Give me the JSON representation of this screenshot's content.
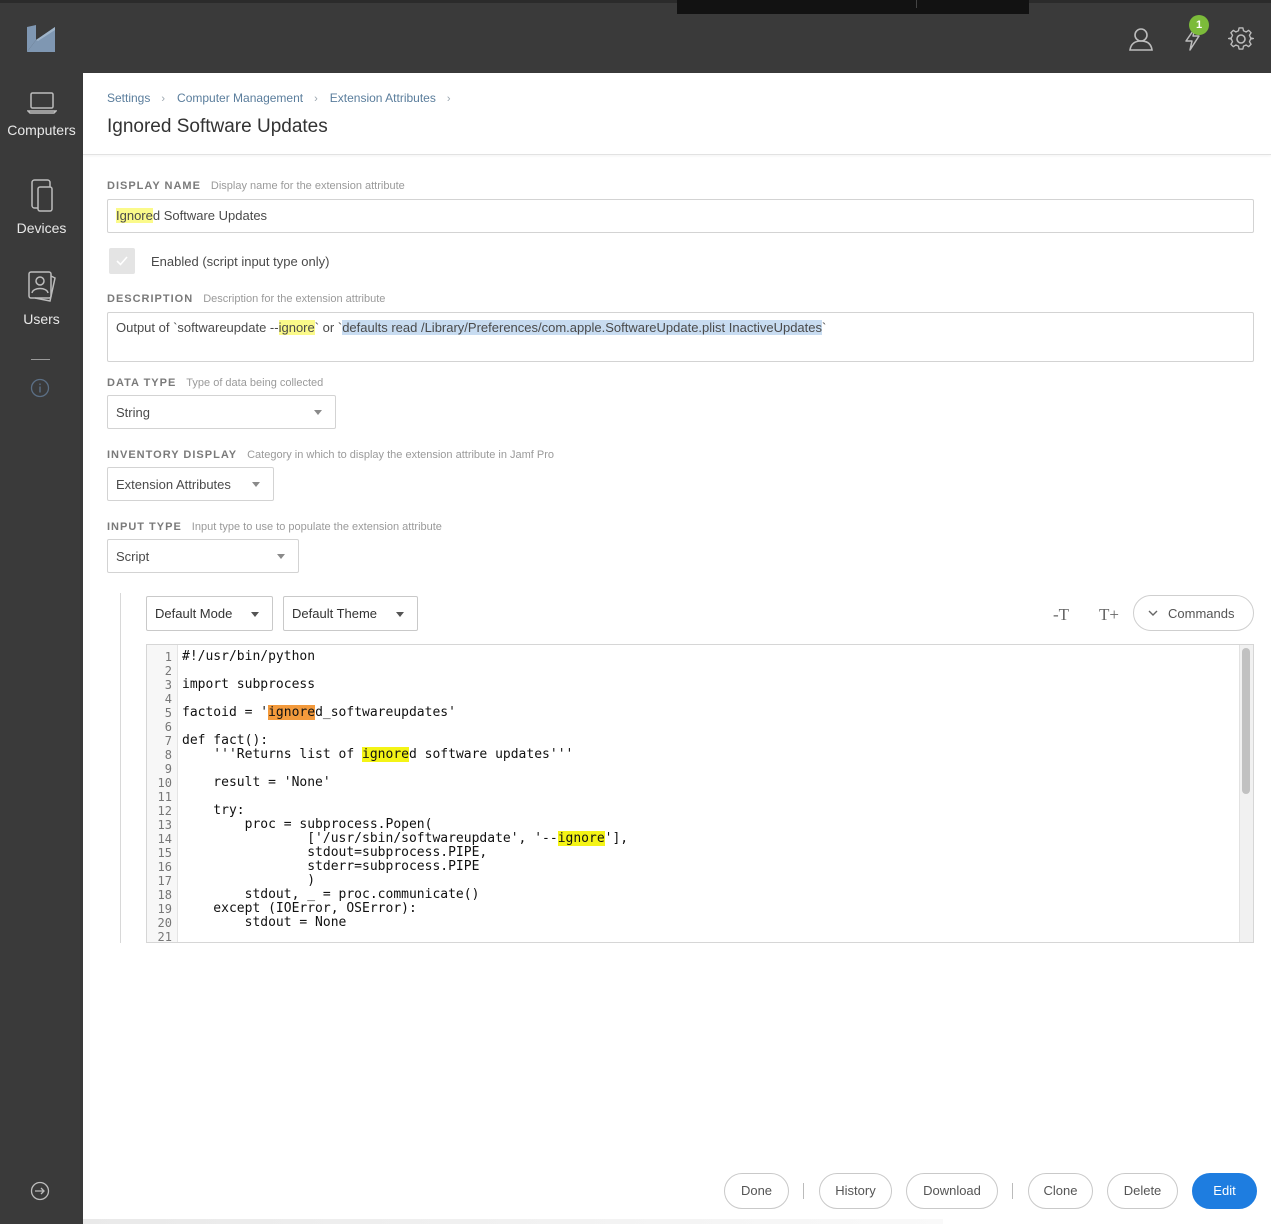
{
  "topbar": {
    "notification_count": "1",
    "icons": [
      "jamf-logo-icon",
      "user-icon",
      "lightning-icon",
      "gear-icon"
    ]
  },
  "sidebar": {
    "items": [
      {
        "label": "Computers",
        "icon": "laptop-icon"
      },
      {
        "label": "Devices",
        "icon": "mobile-devices-icon"
      },
      {
        "label": "Users",
        "icon": "users-icon"
      }
    ]
  },
  "breadcrumb": [
    "Settings",
    "Computer Management",
    "Extension Attributes"
  ],
  "page_title": "Ignored Software Updates",
  "display_name": {
    "label": "DISPLAY NAME",
    "hint": "Display name for the extension attribute",
    "value_hl": "Ignore",
    "value_rest": "d Software Updates"
  },
  "enabled": {
    "label": "Enabled (script input type only)",
    "checked": true
  },
  "description": {
    "label": "DESCRIPTION",
    "hint": "Description for the extension attribute",
    "part1": "Output of `softwareupdate --",
    "part2": "ignore",
    "part3": "` or `",
    "part4": "defaults read /Library/Preferences/com.apple.SoftwareUpdate.plist InactiveUpdates",
    "part5": "`"
  },
  "data_type": {
    "label": "DATA TYPE",
    "hint": "Type of data being collected",
    "value": "String"
  },
  "inventory_display": {
    "label": "INVENTORY DISPLAY",
    "hint": "Category in which to display the extension attribute in Jamf Pro",
    "value": "Extension Attributes"
  },
  "input_type": {
    "label": "INPUT TYPE",
    "hint": "Input type to use to populate the extension attribute",
    "value": "Script"
  },
  "editor": {
    "mode": "Default Mode",
    "theme": "Default Theme",
    "font_decrease": "-T",
    "font_increase": "T+",
    "commands_label": "Commands",
    "line_numbers": [
      "1",
      "2",
      "3",
      "4",
      "5",
      "6",
      "7",
      "8",
      "9",
      "10",
      "11",
      "12",
      "13",
      "14",
      "15",
      "16",
      "17",
      "18",
      "19",
      "20",
      "21"
    ],
    "code": {
      "l1": "#!/usr/bin/python",
      "l3": "import subprocess",
      "l5a": "factoid = '",
      "l5b": "ignore",
      "l5c": "d_softwareupdates'",
      "l7": "def fact():",
      "l8a": "    '''Returns list of ",
      "l8b": "ignore",
      "l8c": "d software updates'''",
      "l10": "    result = 'None'",
      "l12": "    try:",
      "l13": "        proc = subprocess.Popen(",
      "l14a": "                ['/usr/sbin/softwareupdate', '--",
      "l14b": "ignore",
      "l14c": "'],",
      "l15": "                stdout=subprocess.PIPE,",
      "l16": "                stderr=subprocess.PIPE",
      "l17": "                )",
      "l18": "        stdout, _ = proc.communicate()",
      "l19": "    except (IOError, OSError):",
      "l20": "        stdout = None"
    }
  },
  "footer": {
    "done": "Done",
    "history": "History",
    "download": "Download",
    "clone": "Clone",
    "delete": "Delete",
    "edit": "Edit"
  },
  "colors": {
    "accent": "#1e7de0",
    "sidebar_bg": "#3a3a3a",
    "badge": "#7cbb3a",
    "search_highlight": "#fbfa8a",
    "current_match": "#f39a3c"
  }
}
